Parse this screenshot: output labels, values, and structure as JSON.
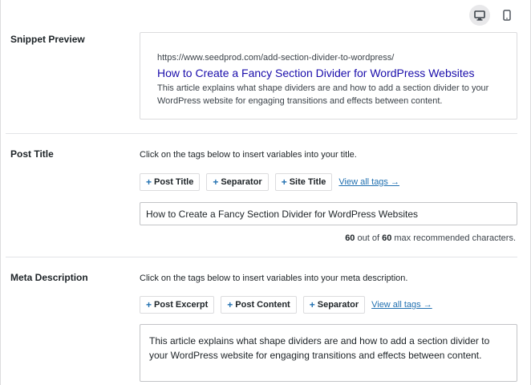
{
  "device_toggle": {
    "desktop_icon": "monitor-icon",
    "mobile_icon": "mobile-icon"
  },
  "snippet": {
    "label": "Snippet Preview",
    "url": "https://www.seedprod.com/add-section-divider-to-wordpress/",
    "title": "How to Create a Fancy Section Divider for WordPress Websites",
    "description": "This article explains what shape dividers are and how to add a section divider to your WordPress website for engaging transitions and effects between content."
  },
  "post_title": {
    "label": "Post Title",
    "hint": "Click on the tags below to insert variables into your title.",
    "tags": [
      "Post Title",
      "Separator",
      "Site Title"
    ],
    "view_all": "View all tags →",
    "value": "How to Create a Fancy Section Divider for WordPress Websites",
    "counter_count": "60",
    "counter_mid": " out of ",
    "counter_max": "60",
    "counter_suffix": " max recommended characters."
  },
  "meta_description": {
    "label": "Meta Description",
    "hint": "Click on the tags below to insert variables into your meta description.",
    "tags": [
      "Post Excerpt",
      "Post Content",
      "Separator"
    ],
    "view_all": "View all tags →",
    "value": "This article explains what shape dividers are and how to add a section divider to your WordPress website for engaging transitions and effects between content."
  },
  "colors": {
    "link": "#2271b1",
    "snippet_title": "#1a0dab",
    "border": "#dcdcde"
  }
}
